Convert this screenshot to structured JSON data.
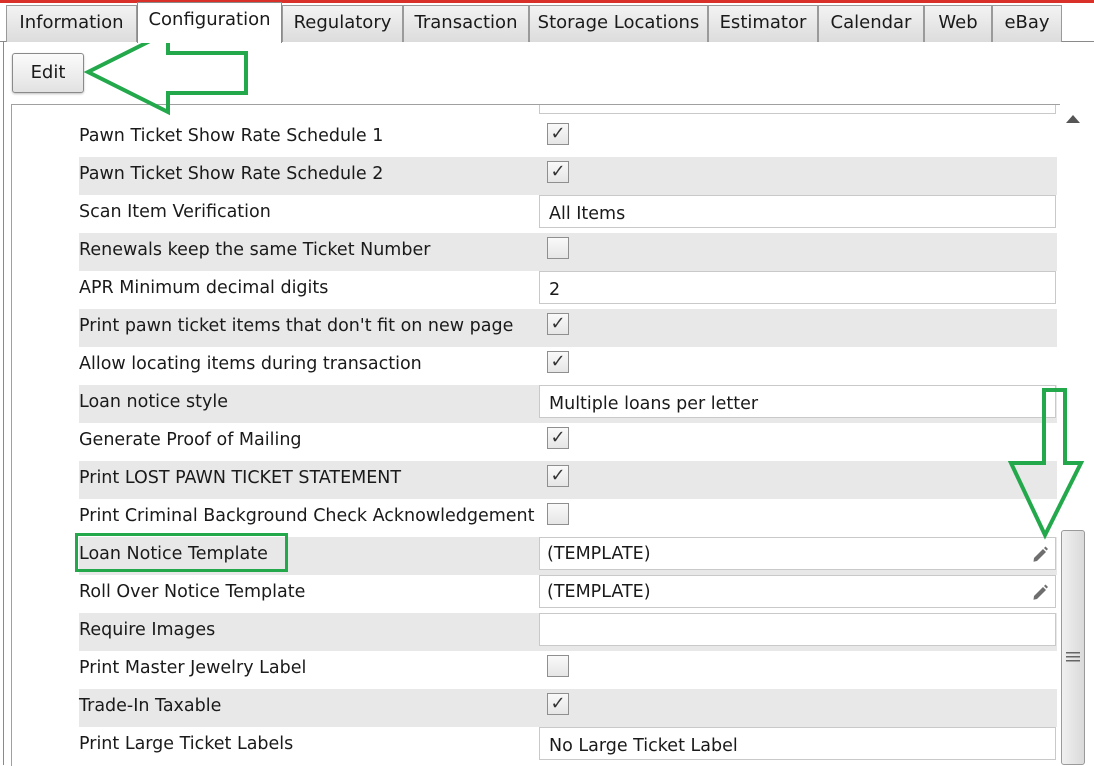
{
  "tabs": [
    {
      "label": "Information",
      "active": false
    },
    {
      "label": "Configuration",
      "active": true
    },
    {
      "label": "Regulatory",
      "active": false
    },
    {
      "label": "Transaction",
      "active": false
    },
    {
      "label": "Storage Locations",
      "active": false
    },
    {
      "label": "Estimator",
      "active": false
    },
    {
      "label": "Calendar",
      "active": false
    },
    {
      "label": "Web",
      "active": false
    },
    {
      "label": "eBay",
      "active": false
    }
  ],
  "toolbar": {
    "edit_label": "Edit"
  },
  "settings": [
    {
      "label": "Pawn Ticket Show Rate Schedule 1",
      "type": "checkbox",
      "checked": true
    },
    {
      "label": "Pawn Ticket Show Rate Schedule 2",
      "type": "checkbox",
      "checked": true
    },
    {
      "label": "Scan Item Verification",
      "type": "text",
      "value": "All Items"
    },
    {
      "label": "Renewals keep the same Ticket Number",
      "type": "checkbox",
      "checked": false
    },
    {
      "label": "APR Minimum decimal digits",
      "type": "text",
      "value": "2"
    },
    {
      "label": "Print pawn ticket items that don't fit on new page",
      "type": "checkbox",
      "checked": true
    },
    {
      "label": "Allow locating items during transaction",
      "type": "checkbox",
      "checked": true
    },
    {
      "label": "Loan notice style",
      "type": "text",
      "value": "Multiple loans per letter"
    },
    {
      "label": "Generate Proof of Mailing",
      "type": "checkbox",
      "checked": true
    },
    {
      "label": "Print LOST PAWN TICKET STATEMENT",
      "type": "checkbox",
      "checked": true
    },
    {
      "label": "Print Criminal Background Check Acknowledgement",
      "type": "checkbox",
      "checked": false
    },
    {
      "label": "Loan Notice Template",
      "type": "template",
      "value": "(TEMPLATE)"
    },
    {
      "label": "Roll Over Notice Template",
      "type": "template",
      "value": "(TEMPLATE)"
    },
    {
      "label": "Require Images",
      "type": "text",
      "value": ""
    },
    {
      "label": "Print Master Jewelry Label",
      "type": "checkbox",
      "checked": false
    },
    {
      "label": "Trade-In Taxable",
      "type": "checkbox",
      "checked": true
    },
    {
      "label": "Print Large Ticket Labels",
      "type": "text",
      "value": "No Large Ticket Label"
    }
  ],
  "checkmark_glyph": "✓",
  "colors": {
    "annotation_green": "#23a94b",
    "alt_row": "#e8e8e8",
    "top_accent": "#d9302a"
  },
  "icons": {
    "edit_template": "pencil-icon",
    "scroll_up": "arrow-up-icon",
    "scroll_grip": "grip-icon"
  }
}
